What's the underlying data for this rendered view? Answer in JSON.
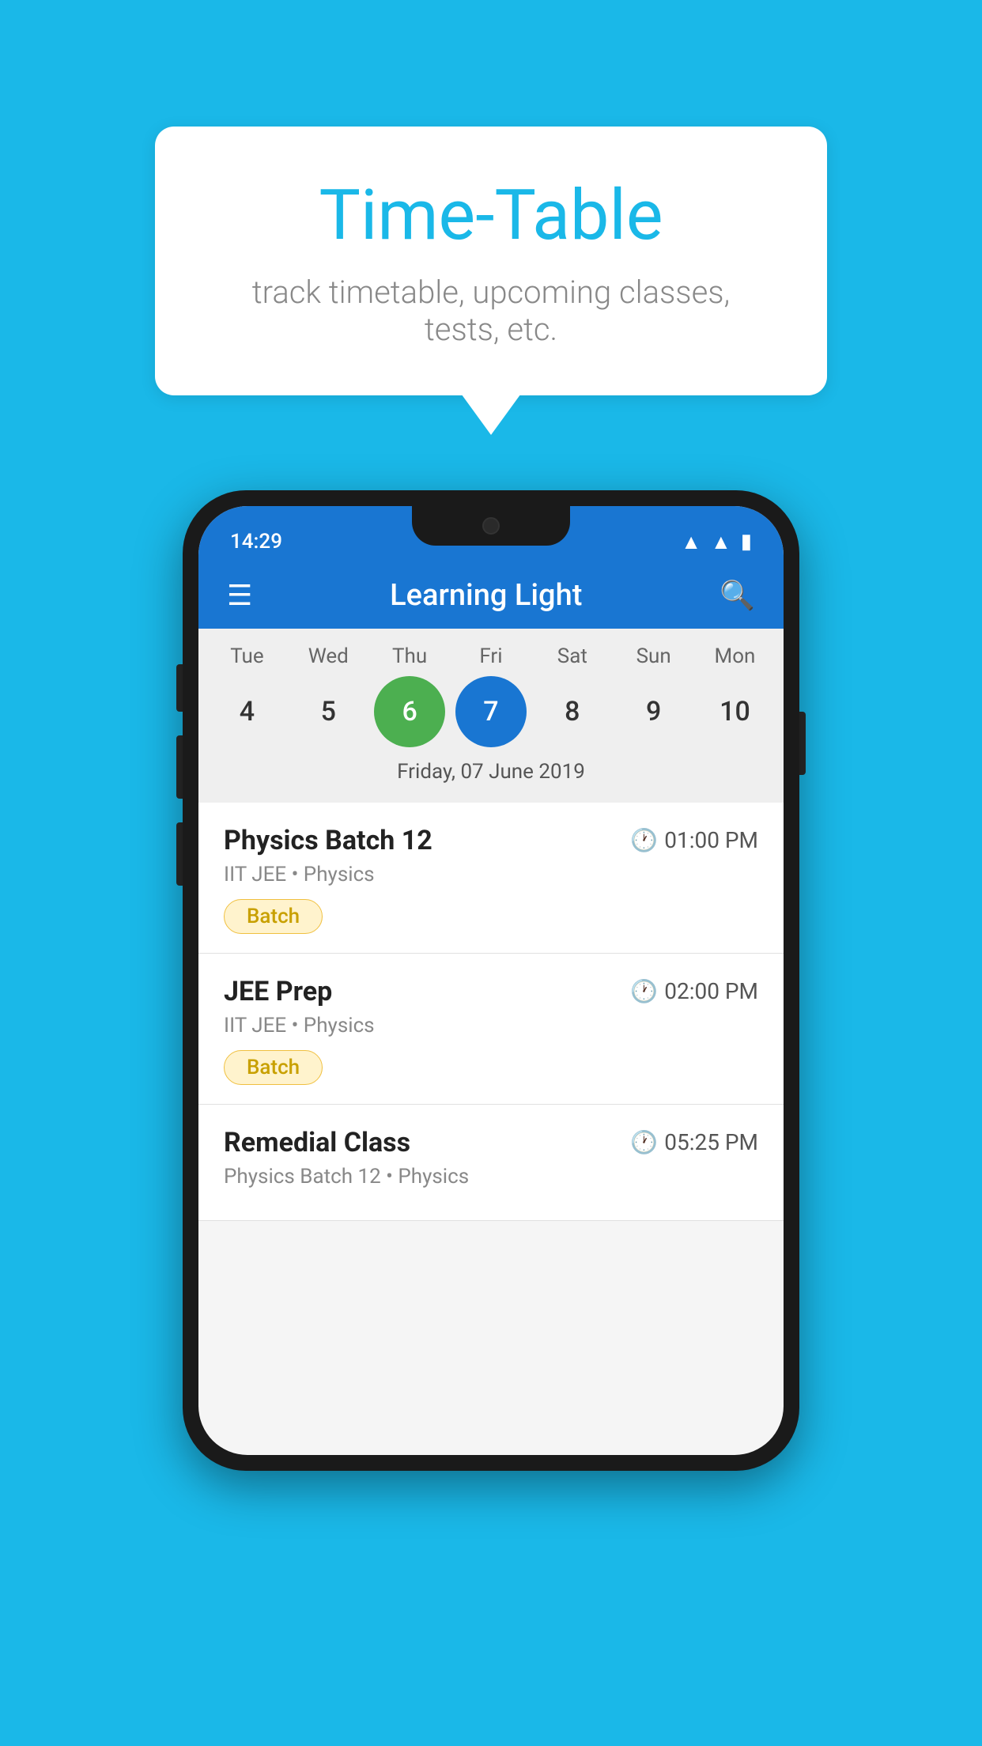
{
  "page": {
    "background_color": "#1ab8e8"
  },
  "bubble": {
    "title": "Time-Table",
    "subtitle": "track timetable, upcoming classes, tests, etc."
  },
  "phone": {
    "status_bar": {
      "time": "14:29"
    },
    "app_bar": {
      "title": "Learning Light"
    },
    "calendar": {
      "days": [
        {
          "label": "Tue",
          "num": "4"
        },
        {
          "label": "Wed",
          "num": "5"
        },
        {
          "label": "Thu",
          "num": "6",
          "state": "today"
        },
        {
          "label": "Fri",
          "num": "7",
          "state": "selected"
        },
        {
          "label": "Sat",
          "num": "8"
        },
        {
          "label": "Sun",
          "num": "9"
        },
        {
          "label": "Mon",
          "num": "10"
        }
      ],
      "date_label": "Friday, 07 June 2019"
    },
    "schedule": [
      {
        "title": "Physics Batch 12",
        "time": "01:00 PM",
        "subtitle": "IIT JEE • Physics",
        "badge": "Batch"
      },
      {
        "title": "JEE Prep",
        "time": "02:00 PM",
        "subtitle": "IIT JEE • Physics",
        "badge": "Batch"
      },
      {
        "title": "Remedial Class",
        "time": "05:25 PM",
        "subtitle": "Physics Batch 12 • Physics",
        "badge": null
      }
    ]
  }
}
